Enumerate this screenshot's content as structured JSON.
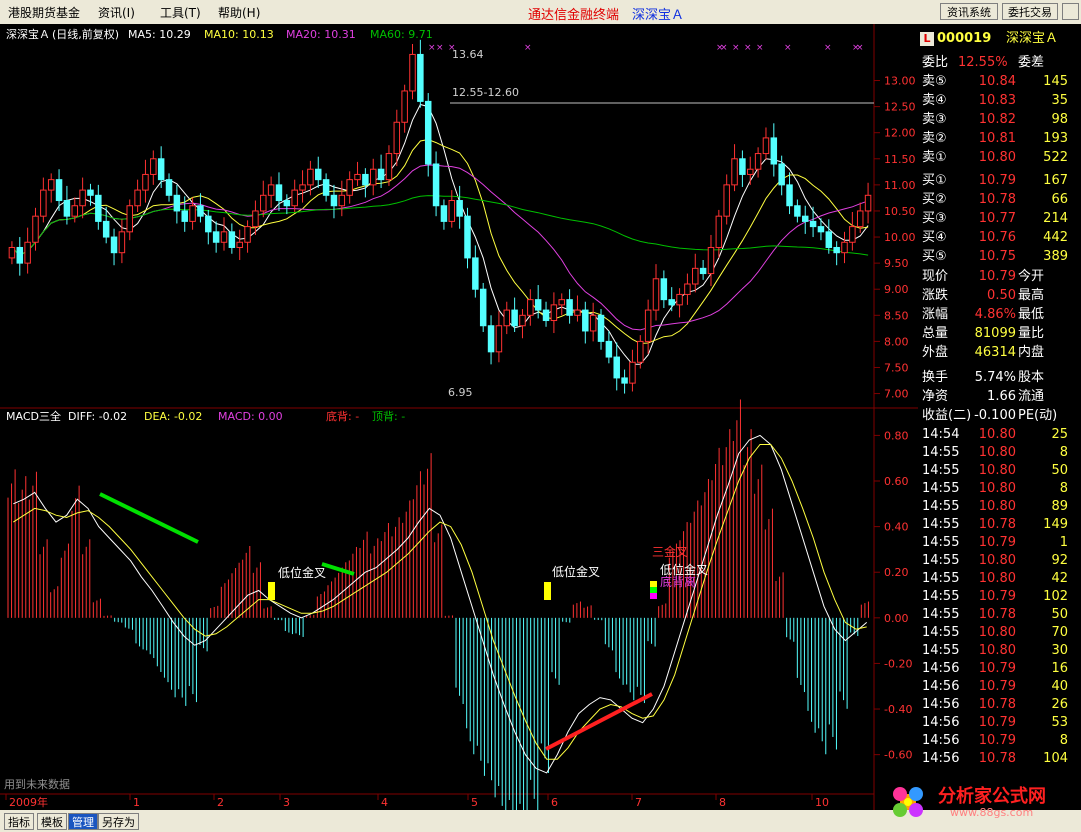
{
  "menu": {
    "items": [
      "港股期货基金",
      "资讯(I)",
      "工具(T)",
      "帮助(H)"
    ]
  },
  "app": {
    "title": "通达信金融终端",
    "stock": "深深宝Ａ",
    "buttons": [
      "资讯系统",
      "委托交易"
    ]
  },
  "main_header": {
    "name": "深深宝Ａ",
    "mode": "(日线,前复权)",
    "ma5": "MA5: 10.29",
    "ma10": "MA10: 10.13",
    "ma20": "MA20: 10.31",
    "ma60": "MA60: 9.71"
  },
  "macd_header": {
    "name": "MACD三全",
    "diff": "DIFF: -0.02",
    "dea": "DEA: -0.02",
    "macd": "MACD: 0.00",
    "dibei": "底背: -",
    "dingbei": "顶背: -"
  },
  "colors": {
    "up": "#ff3232",
    "down": "#54ffff",
    "ma5": "#ffffff",
    "ma10": "#ffff40",
    "ma20": "#e040e0",
    "ma60": "#00c000",
    "grid": "#800000"
  },
  "chart_data": [
    {
      "type": "candlestick",
      "y_ticks": [
        "13.00",
        "12.50",
        "12.00",
        "11.50",
        "11.00",
        "10.50",
        "10.00",
        "9.50",
        "9.00",
        "8.50",
        "8.00",
        "7.50",
        "7.00"
      ],
      "ylim": [
        6.8,
        13.7
      ],
      "high_label": "13.64",
      "low_label": "6.95",
      "level_label": "12.55-12.60",
      "level": 12.57,
      "close": [
        9.8,
        9.5,
        9.9,
        10.4,
        10.9,
        11.1,
        10.7,
        10.4,
        10.6,
        10.9,
        10.8,
        10.3,
        10.0,
        9.7,
        10.1,
        10.6,
        10.9,
        11.2,
        11.5,
        11.1,
        10.8,
        10.5,
        10.3,
        10.6,
        10.4,
        10.1,
        9.9,
        10.1,
        9.8,
        9.9,
        10.2,
        10.5,
        10.8,
        11.0,
        10.7,
        10.6,
        10.9,
        11.0,
        11.3,
        11.1,
        10.8,
        10.6,
        10.8,
        11.1,
        11.2,
        11.0,
        11.3,
        11.1,
        11.6,
        12.2,
        12.8,
        13.5,
        12.6,
        11.4,
        10.6,
        10.3,
        10.7,
        10.4,
        9.6,
        9.0,
        8.3,
        7.8,
        8.3,
        8.6,
        8.3,
        8.5,
        8.8,
        8.6,
        8.4,
        8.7,
        8.8,
        8.5,
        8.6,
        8.2,
        8.5,
        8.0,
        7.7,
        7.3,
        7.2,
        7.6,
        8.0,
        8.6,
        9.2,
        8.8,
        8.7,
        8.9,
        9.1,
        9.4,
        9.3,
        9.8,
        10.4,
        11.0,
        11.5,
        11.2,
        11.3,
        11.6,
        11.9,
        11.4,
        11.0,
        10.6,
        10.4,
        10.3,
        10.2,
        10.1,
        9.8,
        9.7,
        9.9,
        10.2,
        10.5,
        10.8
      ]
    },
    {
      "type": "macd",
      "y_ticks": [
        "0.80",
        "0.60",
        "0.40",
        "0.20",
        "0.00",
        "-0.20",
        "-0.40",
        "-0.60"
      ],
      "ylim": [
        -0.72,
        0.85
      ],
      "annotations": [
        "低位金叉",
        "低位金叉",
        "三金叉",
        "低位金叉",
        "底背离"
      ],
      "x_ticks": [
        "2009年",
        "1",
        "2",
        "3",
        "4",
        "5",
        "6",
        "7",
        "8",
        "10"
      ],
      "diff": [
        0.5,
        0.52,
        0.55,
        0.48,
        0.42,
        0.45,
        0.52,
        0.48,
        0.4,
        0.35,
        0.3,
        0.25,
        0.18,
        0.12,
        0.05,
        -0.02,
        -0.08,
        -0.12,
        -0.1,
        -0.05,
        0.0,
        0.05,
        0.1,
        0.12,
        0.08,
        0.05,
        0.02,
        0.0,
        0.02,
        0.05,
        0.08,
        0.12,
        0.16,
        0.2,
        0.22,
        0.26,
        0.3,
        0.35,
        0.42,
        0.48,
        0.45,
        0.35,
        0.2,
        0.05,
        -0.1,
        -0.25,
        -0.38,
        -0.5,
        -0.6,
        -0.66,
        -0.68,
        -0.6,
        -0.5,
        -0.42,
        -0.38,
        -0.35,
        -0.36,
        -0.4,
        -0.44,
        -0.46,
        -0.4,
        -0.3,
        -0.15,
        0.0,
        0.15,
        0.3,
        0.45,
        0.58,
        0.72,
        0.78,
        0.8,
        0.76,
        0.65,
        0.5,
        0.35,
        0.2,
        0.05,
        -0.05,
        -0.1,
        -0.06,
        -0.02
      ],
      "dea": [
        0.42,
        0.45,
        0.48,
        0.47,
        0.45,
        0.44,
        0.46,
        0.47,
        0.44,
        0.4,
        0.35,
        0.3,
        0.24,
        0.18,
        0.12,
        0.06,
        0.0,
        -0.05,
        -0.08,
        -0.07,
        -0.04,
        0.0,
        0.04,
        0.08,
        0.08,
        0.06,
        0.04,
        0.02,
        0.02,
        0.03,
        0.05,
        0.08,
        0.11,
        0.14,
        0.17,
        0.2,
        0.24,
        0.28,
        0.33,
        0.38,
        0.42,
        0.4,
        0.32,
        0.2,
        0.05,
        -0.1,
        -0.22,
        -0.34,
        -0.45,
        -0.55,
        -0.62,
        -0.62,
        -0.57,
        -0.5,
        -0.45,
        -0.4,
        -0.38,
        -0.39,
        -0.42,
        -0.44,
        -0.43,
        -0.36,
        -0.25,
        -0.1,
        0.05,
        0.2,
        0.34,
        0.47,
        0.6,
        0.7,
        0.76,
        0.76,
        0.7,
        0.6,
        0.48,
        0.35,
        0.2,
        0.08,
        -0.02,
        -0.05,
        -0.04
      ]
    }
  ],
  "quote": {
    "code": "000019",
    "name": "深深宝Ａ",
    "weibi": {
      "label": "委比",
      "value": "12.55%",
      "label2": "委差"
    },
    "sell": [
      {
        "label": "卖⑤",
        "price": "10.84",
        "vol": "145"
      },
      {
        "label": "卖④",
        "price": "10.83",
        "vol": "35"
      },
      {
        "label": "卖③",
        "price": "10.82",
        "vol": "98"
      },
      {
        "label": "卖②",
        "price": "10.81",
        "vol": "193"
      },
      {
        "label": "卖①",
        "price": "10.80",
        "vol": "522"
      }
    ],
    "buy": [
      {
        "label": "买①",
        "price": "10.79",
        "vol": "167"
      },
      {
        "label": "买②",
        "price": "10.78",
        "vol": "66"
      },
      {
        "label": "买③",
        "price": "10.77",
        "vol": "214"
      },
      {
        "label": "买④",
        "price": "10.76",
        "vol": "442"
      },
      {
        "label": "买⑤",
        "price": "10.75",
        "vol": "389"
      }
    ],
    "info": [
      {
        "l1": "现价",
        "v1": "10.79",
        "l2": "今开"
      },
      {
        "l1": "涨跌",
        "v1": "0.50",
        "l2": "最高"
      },
      {
        "l1": "涨幅",
        "v1": "4.86%",
        "l2": "最低"
      },
      {
        "l1": "总量",
        "v1": "81099",
        "l2": "量比"
      },
      {
        "l1": "外盘",
        "v1": "46314",
        "l2": "内盘"
      },
      {
        "l1": "换手",
        "v1": "5.74%",
        "l2": "股本"
      },
      {
        "l1": "净资",
        "v1": "1.66",
        "l2": "流通"
      },
      {
        "l1": "收益(二)",
        "v1": "-0.100",
        "l2": "PE(动)"
      }
    ],
    "ticks": [
      [
        "14:54",
        "10.80",
        "25"
      ],
      [
        "14:55",
        "10.80",
        "8"
      ],
      [
        "14:55",
        "10.80",
        "50"
      ],
      [
        "14:55",
        "10.80",
        "8"
      ],
      [
        "14:55",
        "10.80",
        "89"
      ],
      [
        "14:55",
        "10.78",
        "149"
      ],
      [
        "14:55",
        "10.79",
        "1"
      ],
      [
        "14:55",
        "10.80",
        "92"
      ],
      [
        "14:55",
        "10.80",
        "42"
      ],
      [
        "14:55",
        "10.79",
        "102"
      ],
      [
        "14:55",
        "10.78",
        "50"
      ],
      [
        "14:55",
        "10.80",
        "70"
      ],
      [
        "14:55",
        "10.80",
        "30"
      ],
      [
        "14:56",
        "10.79",
        "16"
      ],
      [
        "14:56",
        "10.79",
        "40"
      ],
      [
        "14:56",
        "10.78",
        "26"
      ],
      [
        "14:56",
        "10.79",
        "53"
      ],
      [
        "14:56",
        "10.79",
        "8"
      ],
      [
        "14:56",
        "10.78",
        "104"
      ]
    ]
  },
  "footer": {
    "future_text": "用到未来数据",
    "tabs": [
      "指标",
      "模板",
      "管理",
      "另存为"
    ]
  },
  "watermark": {
    "text": "分析家公式网",
    "url": "www.88gs.com"
  }
}
